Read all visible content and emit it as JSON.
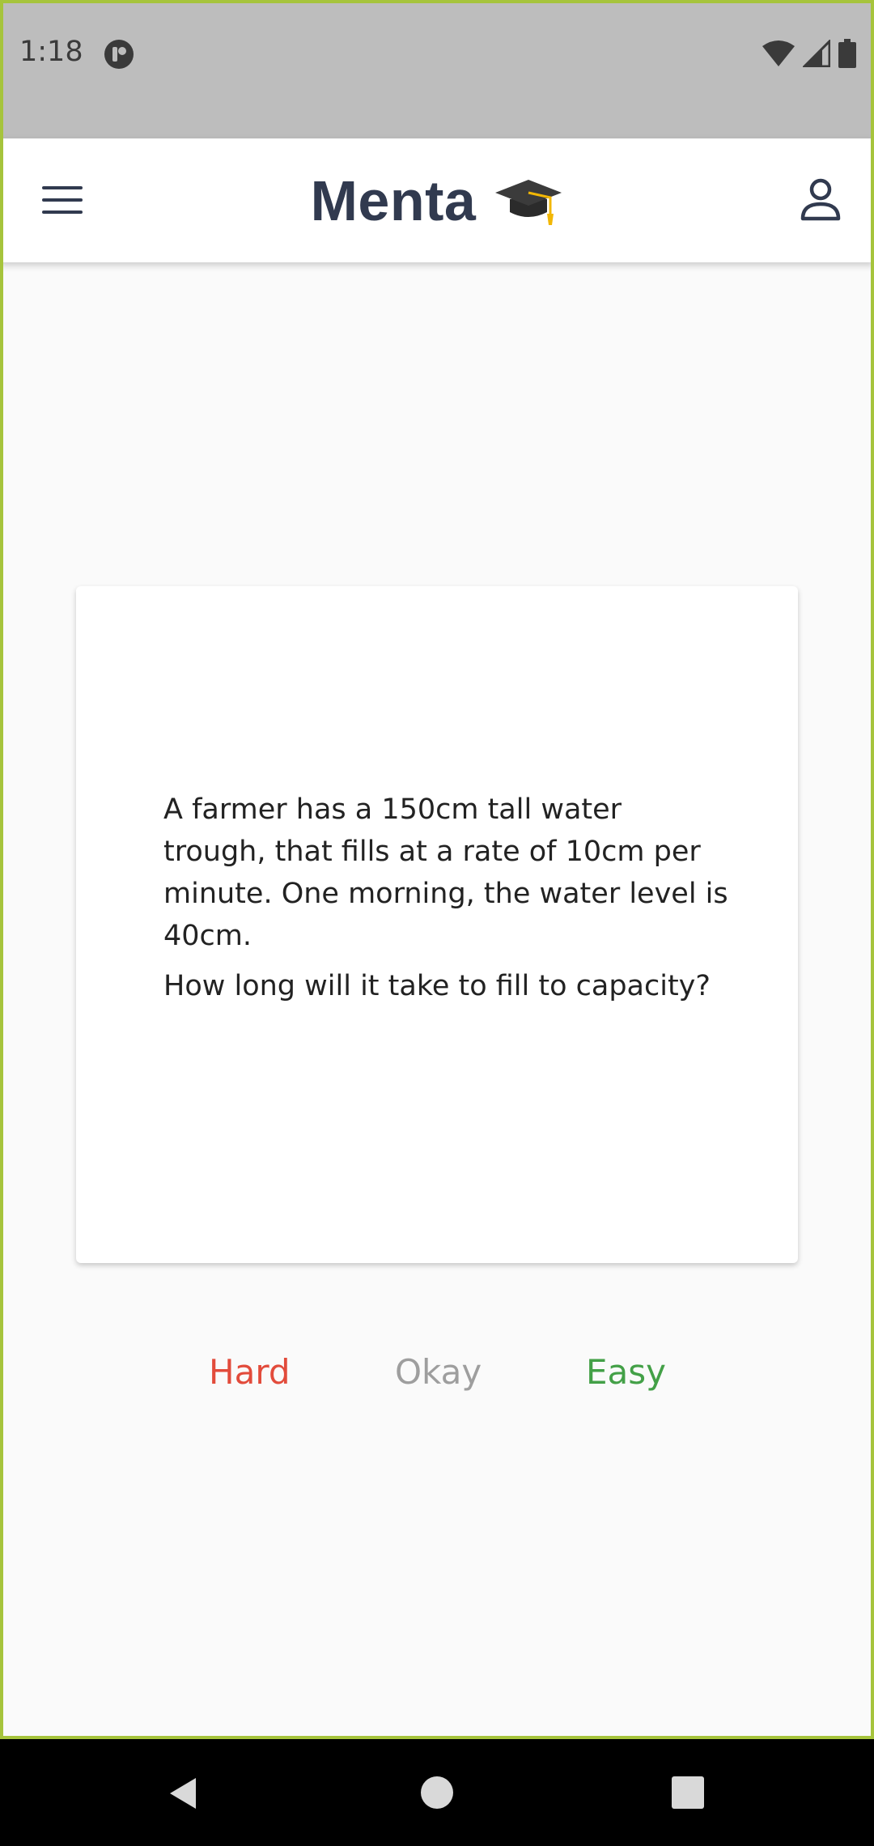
{
  "status_bar": {
    "time": "1:18",
    "icons": [
      "notification-app-icon",
      "wifi-icon",
      "signal-icon",
      "battery-icon"
    ]
  },
  "app_bar": {
    "title": "Menta",
    "icons": [
      "menu-icon",
      "graduation-cap-icon",
      "profile-icon"
    ]
  },
  "card": {
    "question_paragraph_1": "A farmer has a 150cm tall water trough, that fills at a rate of 10cm per minute. One morning, the water level is 40cm.",
    "question_paragraph_2": "How long will it take to fill to capacity?"
  },
  "ratings": {
    "hard": {
      "label": "Hard",
      "color": "#e24b3b"
    },
    "okay": {
      "label": "Okay",
      "color": "#9e9e9e"
    },
    "easy": {
      "label": "Easy",
      "color": "#43a047"
    }
  },
  "nav_bar": {
    "icons": [
      "back-icon",
      "home-icon",
      "recents-icon"
    ]
  },
  "colors": {
    "app_title": "#313a4f",
    "status_bar_bg": "#bdbdbd",
    "page_bg": "#fafafa",
    "frame_border": "#a6c43c"
  }
}
